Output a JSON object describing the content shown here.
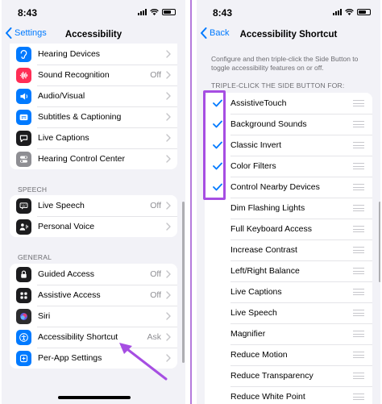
{
  "colors": {
    "accent": "#007aff",
    "annotation": "#a64ee2",
    "background": "#f2f2f7"
  },
  "left": {
    "status_time": "8:43",
    "nav": {
      "back_label": "Settings",
      "title": "Accessibility"
    },
    "hearing_items": [
      {
        "label": "Hearing Devices",
        "value": "",
        "icon": "ear-icon",
        "color": "#007aff"
      },
      {
        "label": "Sound Recognition",
        "value": "Off",
        "icon": "waveform-icon",
        "color": "#ff2d55"
      },
      {
        "label": "Audio/Visual",
        "value": "",
        "icon": "speaker-icon",
        "color": "#007aff"
      },
      {
        "label": "Subtitles & Captioning",
        "value": "",
        "icon": "captions-icon",
        "color": "#007aff"
      },
      {
        "label": "Live Captions",
        "value": "",
        "icon": "speech-bubble-icon",
        "color": "#1c1c1e"
      },
      {
        "label": "Hearing Control Center",
        "value": "",
        "icon": "toggles-icon",
        "color": "#8e8e93"
      }
    ],
    "speech_header": "SPEECH",
    "speech_items": [
      {
        "label": "Live Speech",
        "value": "Off",
        "icon": "keyboard-bubble-icon",
        "color": "#1c1c1e"
      },
      {
        "label": "Personal Voice",
        "value": "",
        "icon": "waveform-person-icon",
        "color": "#1c1c1e"
      }
    ],
    "general_header": "GENERAL",
    "general_items": [
      {
        "label": "Guided Access",
        "value": "Off",
        "icon": "lock-icon",
        "color": "#1c1c1e"
      },
      {
        "label": "Assistive Access",
        "value": "Off",
        "icon": "grid-icon",
        "color": "#1c1c1e"
      },
      {
        "label": "Siri",
        "value": "",
        "icon": "siri-icon",
        "color": "#2c2c2e"
      },
      {
        "label": "Accessibility Shortcut",
        "value": "Ask",
        "icon": "accessibility-icon",
        "color": "#007aff"
      },
      {
        "label": "Per-App Settings",
        "value": "",
        "icon": "app-settings-icon",
        "color": "#007aff"
      }
    ]
  },
  "right": {
    "status_time": "8:43",
    "nav": {
      "back_label": "Back",
      "title": "Accessibility Shortcut"
    },
    "description": "Configure and then triple-click the Side Button to toggle accessibility features on or off.",
    "list_header": "TRIPLE-CLICK THE SIDE BUTTON FOR:",
    "items": [
      {
        "label": "AssistiveTouch",
        "checked": true
      },
      {
        "label": "Background Sounds",
        "checked": true
      },
      {
        "label": "Classic Invert",
        "checked": true
      },
      {
        "label": "Color Filters",
        "checked": true
      },
      {
        "label": "Control Nearby Devices",
        "checked": true
      },
      {
        "label": "Dim Flashing Lights",
        "checked": false
      },
      {
        "label": "Full Keyboard Access",
        "checked": false
      },
      {
        "label": "Increase Contrast",
        "checked": false
      },
      {
        "label": "Left/Right Balance",
        "checked": false
      },
      {
        "label": "Live Captions",
        "checked": false
      },
      {
        "label": "Live Speech",
        "checked": false
      },
      {
        "label": "Magnifier",
        "checked": false
      },
      {
        "label": "Reduce Motion",
        "checked": false
      },
      {
        "label": "Reduce Transparency",
        "checked": false
      },
      {
        "label": "Reduce White Point",
        "checked": false
      }
    ]
  }
}
